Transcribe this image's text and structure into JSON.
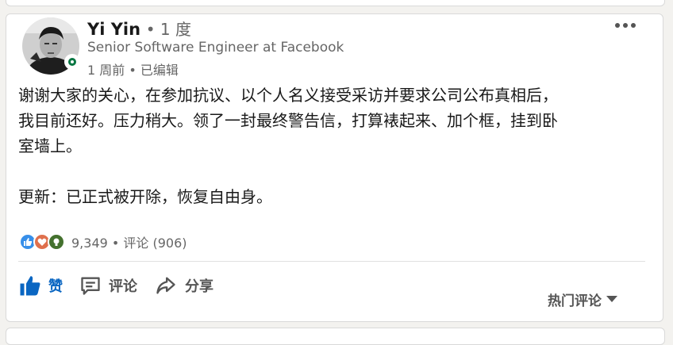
{
  "post": {
    "author_name": "Yi Yin",
    "connection_degree": "• 1 度",
    "headline": "Senior Software Engineer at Facebook",
    "timestamp": "1 周前 • 已编辑",
    "body_line1": "谢谢大家的关心，在参加抗议、以个人名义接受采访并要求公司公布真相后，",
    "body_line2": "我目前还好。压力稍大。领了一封最终警告信，打算裱起来、加个框，挂到卧",
    "body_line3": "室墙上。",
    "update_text": "更新：已正式被开除，恢复自由身。"
  },
  "social": {
    "counts_text": "9,349 • 评论 (906)",
    "reactions": [
      "like",
      "love",
      "insightful"
    ]
  },
  "actions": {
    "like_label": "赞",
    "comment_label": "评论",
    "share_label": "分享",
    "sort_label": "热门评论"
  },
  "colors": {
    "brand_blue": "#0a66c2",
    "presence_green": "#057642",
    "like_blue": "#378fe9",
    "love_red": "#df704d",
    "insight_green": "#44712e"
  }
}
